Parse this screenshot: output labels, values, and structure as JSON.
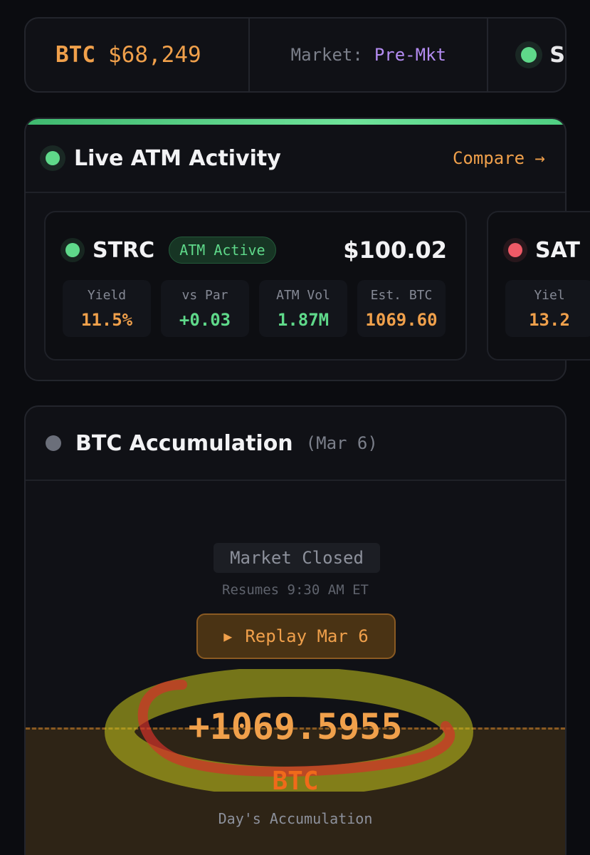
{
  "ticker": {
    "btc_symbol": "BTC",
    "btc_price": "$68,249",
    "market_label": "Market:",
    "market_value": "Pre-Mkt",
    "third_cell_text": "S"
  },
  "atm": {
    "title": "Live ATM Activity",
    "compare_label": "Compare →",
    "tiles": [
      {
        "symbol": "STRC",
        "badge": "ATM Active",
        "price": "$100.02",
        "status": "green",
        "stats": [
          {
            "label": "Yield",
            "value": "11.5%"
          },
          {
            "label": "vs Par",
            "value": "+0.03"
          },
          {
            "label": "ATM Vol",
            "value": "1.87M"
          },
          {
            "label": "Est. BTC",
            "value": "1069.60"
          }
        ]
      },
      {
        "symbol": "SAT",
        "status": "red",
        "stats": [
          {
            "label": "Yiel",
            "value": "13.2"
          }
        ]
      }
    ]
  },
  "accumulation": {
    "title": "BTC Accumulation",
    "date": "(Mar 6)",
    "market_status": "Market Closed",
    "resumes": "Resumes 9:30 AM ET",
    "replay_label": "Replay Mar 6",
    "total": "+1069.5955",
    "unit": "BTC",
    "caption": "Day's Accumulation"
  },
  "colors": {
    "accent_orange": "#f0a04b",
    "accent_green": "#5fd98a",
    "accent_purple": "#b48cf2",
    "alert_red": "#ef5a67",
    "highlight_yellow": "#c8c81e",
    "annotation_red": "#d2322a"
  }
}
